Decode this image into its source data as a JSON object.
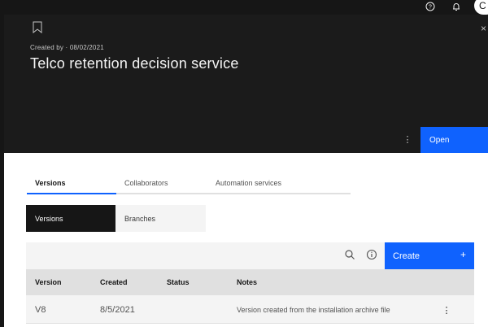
{
  "global_header": {
    "help_icon": "help-icon",
    "notification_icon": "bell-icon",
    "avatar_initial": "C"
  },
  "panel": {
    "created_by": "Created by · 08/02/2021",
    "title": "Telco retention decision service",
    "overflow_glyph": "⋮",
    "close_glyph": "×",
    "open_label": "Open"
  },
  "tabs": [
    {
      "label": "Versions",
      "active": true
    },
    {
      "label": "Collaborators",
      "active": false
    },
    {
      "label": "Automation services",
      "active": false
    }
  ],
  "switcher": {
    "versions_label": "Versions",
    "branches_label": "Branches",
    "selected": "Versions"
  },
  "table": {
    "create_label": "Create",
    "create_plus": "+",
    "columns": [
      "Version",
      "Created",
      "Status",
      "Notes"
    ],
    "rows": [
      {
        "version": "V8",
        "created": "8/5/2021",
        "status": "",
        "notes": "Version created from the installation archive file",
        "overflow": "⋮"
      }
    ]
  },
  "colors": {
    "accent": "#0f62fe",
    "dark_bg": "#161616",
    "panel_bg": "#1b1b1b",
    "surface": "#f4f4f4",
    "header_row": "#e0e0e0"
  }
}
